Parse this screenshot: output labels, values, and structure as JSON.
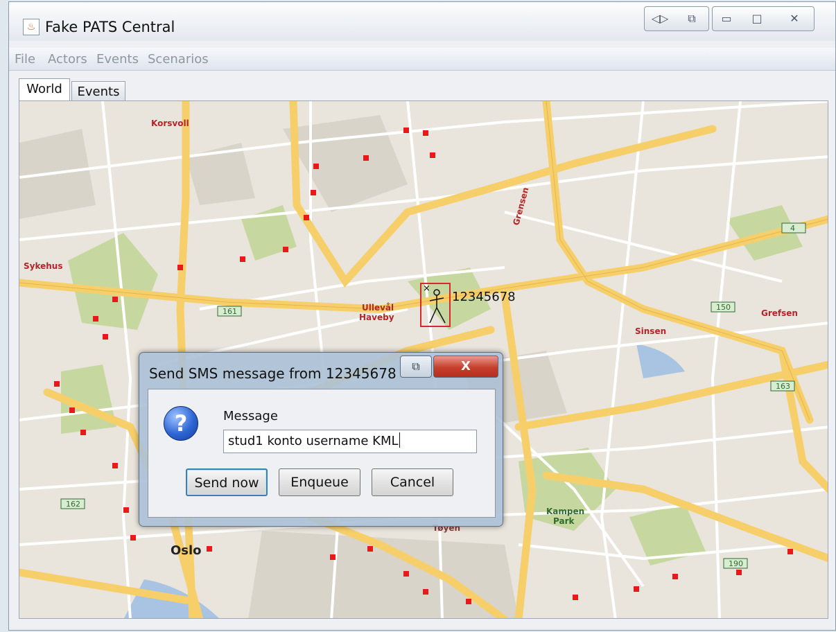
{
  "window": {
    "title": "Fake PATS Central",
    "controls": [
      "◁▷",
      "⧉",
      "▭",
      "□",
      "✕"
    ]
  },
  "menubar": {
    "items": [
      "File",
      "Actors",
      "Events",
      "Scenarios"
    ]
  },
  "tabs": [
    "World",
    "Events"
  ],
  "map": {
    "labels": {
      "oslo": "Oslo",
      "ulleval": "Ullevål",
      "haveby": "Haveby",
      "kampen_park": "Kampen",
      "park": "Park",
      "toyen": "Tøyen",
      "grefsen": "Grefsen",
      "sinsen": "Sinsen",
      "sykehus": "Sykehus",
      "korsvoll": "Korsvoll",
      "grensen": "Grensen"
    },
    "road_numbers": [
      "161",
      "150",
      "4",
      "162",
      "163",
      "190"
    ]
  },
  "actor": {
    "phone": "12345678",
    "close_mark": "×"
  },
  "dialog": {
    "title": "Send SMS message from 12345678",
    "restore_glyph": "⧉",
    "close_glyph": "X",
    "help_glyph": "?",
    "message_label": "Message",
    "message_value": "stud1 konto username KML",
    "buttons": {
      "send": "Send now",
      "enqueue": "Enqueue",
      "cancel": "Cancel"
    }
  },
  "colors": {
    "map_background": "#e9e5dc",
    "park": "#c6d8a0",
    "major_road": "#f7cf6a",
    "minor_road": "#ffffff",
    "actor_marker": "#e8191a",
    "selection": "#d9272e"
  }
}
